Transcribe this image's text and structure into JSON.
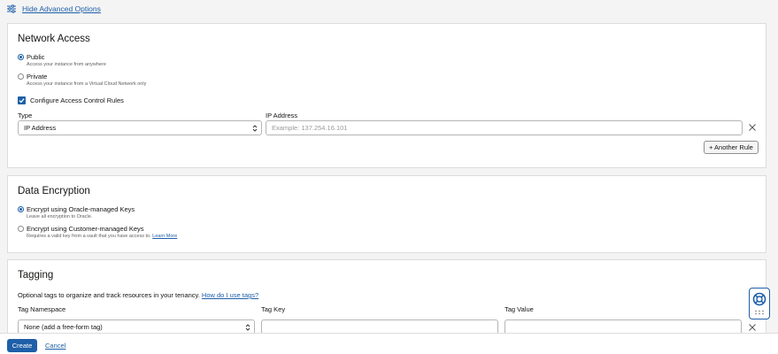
{
  "advanced_toggle": {
    "label": "Hide Advanced Options",
    "icon": "sliders-icon"
  },
  "network_access": {
    "title": "Network Access",
    "options": [
      {
        "label": "Public",
        "help": "Access your instance from anywhere",
        "selected": true
      },
      {
        "label": "Private",
        "help": "Access your instance from a Virtual Cloud Network only",
        "selected": false
      }
    ],
    "configure_rules": {
      "label": "Configure Access Control Rules",
      "checked": true
    },
    "type_label": "Type",
    "type_value": "IP Address",
    "ip_label": "IP Address",
    "ip_placeholder": "Example: 137.254.16.101",
    "another_rule_label": "+ Another Rule"
  },
  "data_encryption": {
    "title": "Data Encryption",
    "options": [
      {
        "label": "Encrypt using Oracle-managed Keys",
        "help": "Leave all encryption to Oracle.",
        "selected": true
      },
      {
        "label": "Encrypt using Customer-managed Keys",
        "help": "Requires a valid key from a vault that you have access to.",
        "link": "Learn More",
        "selected": false
      }
    ]
  },
  "tagging": {
    "title": "Tagging",
    "intro": "Optional tags to organize and track resources in your tenancy.",
    "intro_link": "How do I use tags?",
    "namespace_label": "Tag Namespace",
    "namespace_value": "None (add a free-form tag)",
    "key_label": "Tag Key",
    "value_label": "Tag Value"
  },
  "footer": {
    "create_label": "Create",
    "cancel_label": "Cancel"
  },
  "colors": {
    "accent": "#1e5fa8",
    "card_bg": "#ffffff",
    "page_bg": "#f4f4f4"
  }
}
